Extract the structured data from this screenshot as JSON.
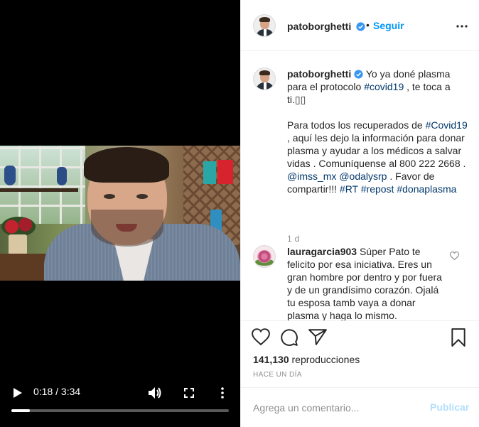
{
  "post": {
    "username": "patoborghetti",
    "follow_label": "Seguir",
    "dot": "•"
  },
  "video": {
    "time": "0:18 / 3:34",
    "progress_fraction": 0.084
  },
  "caption": {
    "username": "patoborghetti",
    "line1": "Yo ya doné plasma para el protocolo ",
    "tag_covid19": "#covid19",
    "line1_end": " , te toca a ti.▯▯",
    "line2_a": "Para todos los recuperados de ",
    "tag_Covid19": "#Covid19",
    "line2_b": " , aquí les dejo la información para donar plasma y ayudar a los médicos a salvar vidas . Comuníquense al 800 222 2668 . ",
    "mention_imss": "@imss_mx",
    "mention_odaly": "@odalysrp",
    "line2_c": " . Favor de compartir!!! ",
    "tag_RT": "#RT",
    "tag_repost": "#repost",
    "tag_donaplasma": "#donaplasma",
    "time": "1 d"
  },
  "comment": {
    "username": "lauragarcia903",
    "text": "Súper Pato te felicito por esa iniciativa. Eres un gran hombre por dentro y por fuera y de un grandísimo corazón. Ojalá tu esposa tamb vaya a donar plasma y haga lo mismo."
  },
  "stats": {
    "views_count": "141,130",
    "views_label": "reproducciones",
    "posted": "HACE UN DÍA"
  },
  "composer": {
    "placeholder": "Agrega un comentario...",
    "publish_label": "Publicar"
  },
  "colors": {
    "link_blue": "#0095f6",
    "hashtag": "#00376b",
    "muted": "#8e8e8e",
    "publish_disabled": "#b2dffc"
  },
  "icons": [
    "play-icon",
    "volume-icon",
    "fullscreen-icon",
    "more-vertical-icon",
    "verified-icon",
    "more-horizontal-icon",
    "heart-icon",
    "comment-icon",
    "share-icon",
    "bookmark-icon"
  ]
}
